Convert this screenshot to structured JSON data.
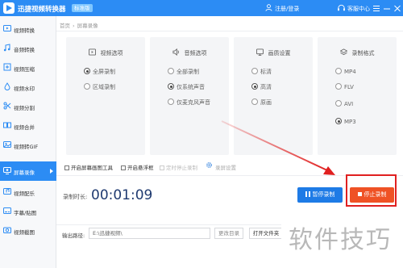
{
  "app": {
    "title": "迅捷视频转换器",
    "edition": "标准版",
    "login_label": "注册/登录",
    "vip_label": "客服中心",
    "window_buttons": [
      "menu",
      "minimize",
      "close"
    ]
  },
  "sidebar": {
    "items": [
      {
        "label": "视频转换",
        "icon": "video-convert-icon",
        "active": false
      },
      {
        "label": "音频转换",
        "icon": "audio-convert-icon",
        "active": false
      },
      {
        "label": "视频压缩",
        "icon": "video-compress-icon",
        "active": false
      },
      {
        "label": "视频水印",
        "icon": "video-watermark-icon",
        "active": false
      },
      {
        "label": "视频分割",
        "icon": "video-split-icon",
        "active": false
      },
      {
        "label": "视频合并",
        "icon": "video-merge-icon",
        "active": false
      },
      {
        "label": "视频转GIF",
        "icon": "video-gif-icon",
        "active": false
      },
      {
        "label": "屏幕录像",
        "icon": "screen-record-icon",
        "active": true
      },
      {
        "label": "视频配乐",
        "icon": "video-music-icon",
        "active": false
      },
      {
        "label": "字幕/贴图",
        "icon": "subtitle-icon",
        "active": false
      },
      {
        "label": "视频截图",
        "icon": "video-screenshot-icon",
        "active": false
      }
    ]
  },
  "breadcrumb": {
    "home": "首页",
    "separator": "›",
    "current": "屏幕录像"
  },
  "panels": [
    {
      "title": "视频选项",
      "icon": "monitor-icon",
      "options": [
        {
          "label": "全屏录制",
          "selected": true
        },
        {
          "label": "区域录制",
          "selected": false
        }
      ]
    },
    {
      "title": "音频选项",
      "icon": "speaker-icon",
      "options": [
        {
          "label": "全部录制",
          "selected": false
        },
        {
          "label": "仅系统声音",
          "selected": true
        },
        {
          "label": "仅麦克风声音",
          "selected": false
        }
      ]
    },
    {
      "title": "画质设置",
      "icon": "display-quality-icon",
      "options": [
        {
          "label": "标清",
          "selected": false
        },
        {
          "label": "高清",
          "selected": true
        },
        {
          "label": "原画",
          "selected": false
        }
      ]
    },
    {
      "title": "录制格式",
      "icon": "layers-icon",
      "options": [
        {
          "label": "MP4",
          "selected": false
        },
        {
          "label": "FLV",
          "selected": false
        },
        {
          "label": "AVI",
          "selected": false
        },
        {
          "label": "MP3",
          "selected": true
        }
      ]
    }
  ],
  "checkboxes": [
    {
      "label": "开启屏幕画图工具",
      "checked": false,
      "disabled": false
    },
    {
      "label": "开启悬浮框",
      "checked": false,
      "disabled": false
    },
    {
      "label": "定时停止录制",
      "checked": false,
      "disabled": true
    }
  ],
  "advanced": {
    "label": "录屏设置",
    "icon": "gear-icon"
  },
  "recording": {
    "label": "录制时长:",
    "time": "00:01:09"
  },
  "buttons": {
    "pause": "暂停录制",
    "stop": "停止录制"
  },
  "output": {
    "label": "输出路径:",
    "path": "E:\\迅捷视频\\",
    "change_dir": "更改目录",
    "open_folder": "打开文件夹"
  },
  "watermark": "软件技巧",
  "colors": {
    "title_bar": "#2c8cf4",
    "active_nav": "#2c8cf4",
    "pause_button": "#1e7be6",
    "stop_button": "#ef5225",
    "annotation": "#e02020",
    "timer": "#1f3a70"
  }
}
